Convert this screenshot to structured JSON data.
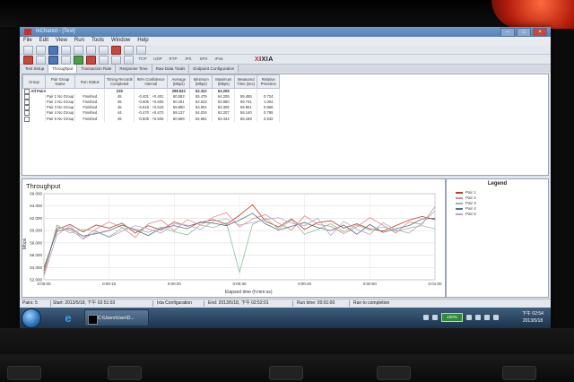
{
  "window": {
    "title": "IxChariot - [Test]"
  },
  "menu": [
    "File",
    "Edit",
    "View",
    "Run",
    "Tools",
    "Window",
    "Help"
  ],
  "logo": {
    "prefix": "X",
    "text": "IXIA"
  },
  "toolbar_tags": [
    "TCP",
    "UDP",
    "RTP",
    "IPX",
    "SPX",
    "IPv6"
  ],
  "tabs": [
    "Test Setup",
    "Throughput",
    "Transaction Rate",
    "Response Time",
    "Raw Data Totals",
    "Endpoint Configuration"
  ],
  "table": {
    "headers": [
      "Group",
      "Pair Group Name",
      "Run Status",
      "Timing Records Completed",
      "95% Confidence Interval",
      "Average (Mbps)",
      "Minimum (Mbps)",
      "Maximum (Mbps)",
      "Measured Time (sec)",
      "Relative Precision"
    ],
    "summary": {
      "label": "All Pairs",
      "records": "225",
      "average": "298.522",
      "minimum": "52.322",
      "maximum": "64.205"
    },
    "rows": [
      {
        "pair": "Pair 1",
        "group": "No Group",
        "status": "Finished",
        "records": "45",
        "ci": "-0.401 : +0.401",
        "avg": "60.552",
        "min": "55.479",
        "max": "64.205",
        "time": "59.455",
        "rp": "0.724"
      },
      {
        "pair": "Pair 2",
        "group": "No Group",
        "status": "Finished",
        "records": "45",
        "ci": "-0.605 : +0.605",
        "avg": "60.281",
        "min": "52.522",
        "max": "63.990",
        "time": "59.731",
        "rp": "1.004"
      },
      {
        "pair": "Pair 3",
        "group": "No Group",
        "status": "Finished",
        "records": "45",
        "ci": "-0.518 : +0.518",
        "avg": "59.680",
        "min": "53.001",
        "max": "63.305",
        "time": "59.851",
        "rp": "0.868"
      },
      {
        "pair": "Pair 4",
        "group": "No Group",
        "status": "Finished",
        "records": "44",
        "ci": "-0.470 : +0.470",
        "avg": "59.137",
        "min": "54.034",
        "max": "62.207",
        "time": "59.140",
        "rp": "0.795"
      },
      {
        "pair": "Pair 5",
        "group": "No Group",
        "status": "Finished",
        "records": "45",
        "ci": "-0.505 : +0.505",
        "avg": "60.669",
        "min": "54.681",
        "max": "63.444",
        "time": "59.159",
        "rp": "0.832"
      }
    ]
  },
  "chart_data": {
    "type": "line",
    "title": "Throughput",
    "xlabel": "Elapsed time (h:mm:ss)",
    "ylabel": "Mbps",
    "ylim": [
      52,
      66
    ],
    "yticks": [
      "66.000",
      "64.000",
      "62.000",
      "60.000",
      "58.000",
      "56.000",
      "54.000",
      "52.000"
    ],
    "xticks": [
      "0:00:00",
      "0:00:10",
      "0:00:20",
      "0:00:30",
      "0:00:40",
      "0:00:50",
      "0:01:00"
    ],
    "x": [
      0,
      2,
      4,
      6,
      8,
      10,
      12,
      14,
      16,
      18,
      20,
      22,
      24,
      26,
      28,
      30,
      32,
      34,
      36,
      38,
      40,
      42,
      44,
      46,
      48,
      50,
      52,
      54,
      56,
      58,
      60
    ],
    "series": [
      {
        "name": "Pair 1",
        "color": "#c0392b",
        "values": [
          53.5,
          60.2,
          61.0,
          59.8,
          60.9,
          60.4,
          61.2,
          59.6,
          60.8,
          60.1,
          61.4,
          60.7,
          61.3,
          61.8,
          61.0,
          62.5,
          64.2,
          61.5,
          60.6,
          61.9,
          60.2,
          61.3,
          61.6,
          60.4,
          61.1,
          60.3,
          59.9,
          60.8,
          61.7,
          62.3,
          61.8
        ]
      },
      {
        "name": "Pair 2",
        "color": "#d98b8b",
        "values": [
          52.8,
          60.6,
          60.1,
          58.7,
          60.3,
          61.4,
          60.5,
          58.9,
          61.1,
          61.7,
          60.0,
          61.8,
          60.9,
          62.2,
          62.9,
          60.6,
          61.9,
          62.6,
          61.2,
          60.1,
          62.4,
          61.0,
          60.7,
          59.5,
          60.6,
          62.1,
          60.9,
          59.6,
          61.4,
          61.0,
          63.9
        ]
      },
      {
        "name": "Pair 3",
        "color": "#8fbf9a",
        "values": [
          53.1,
          60.9,
          59.6,
          60.2,
          59.9,
          59.0,
          60.4,
          60.3,
          59.7,
          60.6,
          59.8,
          59.3,
          60.9,
          60.5,
          61.3,
          53.2,
          61.0,
          62.0,
          60.3,
          61.7,
          59.4,
          60.2,
          61.1,
          59.8,
          60.9,
          60.1,
          60.6,
          59.9,
          60.4,
          60.8,
          60.3
        ]
      },
      {
        "name": "Pair 4",
        "color": "#5b6f7c",
        "values": [
          54.0,
          59.9,
          60.4,
          59.1,
          59.5,
          60.0,
          60.9,
          60.1,
          59.2,
          60.4,
          60.8,
          60.3,
          61.4,
          61.2,
          60.8,
          61.7,
          62.8,
          61.1,
          60.1,
          60.7,
          61.3,
          60.5,
          60.0,
          60.9,
          59.4,
          61.0,
          59.7,
          60.3,
          60.8,
          61.9,
          62.0
        ]
      },
      {
        "name": "Pair 5",
        "color": "#b7a6c9",
        "values": [
          52.6,
          59.3,
          60.8,
          58.6,
          59.8,
          58.9,
          59.9,
          60.8,
          60.3,
          59.6,
          61.1,
          60.9,
          60.2,
          61.5,
          61.9,
          60.9,
          61.3,
          61.8,
          62.1,
          61.2,
          60.8,
          62.0,
          59.2,
          61.5,
          60.2,
          59.4,
          61.3,
          60.1,
          59.6,
          61.2,
          63.2
        ]
      }
    ]
  },
  "legend": {
    "title": "Legend"
  },
  "status": {
    "pairs": "Pairs: 5",
    "start": "Start: 2013/5/18, 下午 02:51:03",
    "config": "Ixia Configuration",
    "end": "End: 2013/5/18, 下午 02:52:01",
    "runtime": "Run time: 00:01:00",
    "completion": "Ran to completion"
  },
  "taskbar": {
    "cmd_label": "C:\\Users\\User\\D...",
    "battery": "100%",
    "clock_period": "下午 02:54",
    "clock_date": "2013/5/18"
  }
}
